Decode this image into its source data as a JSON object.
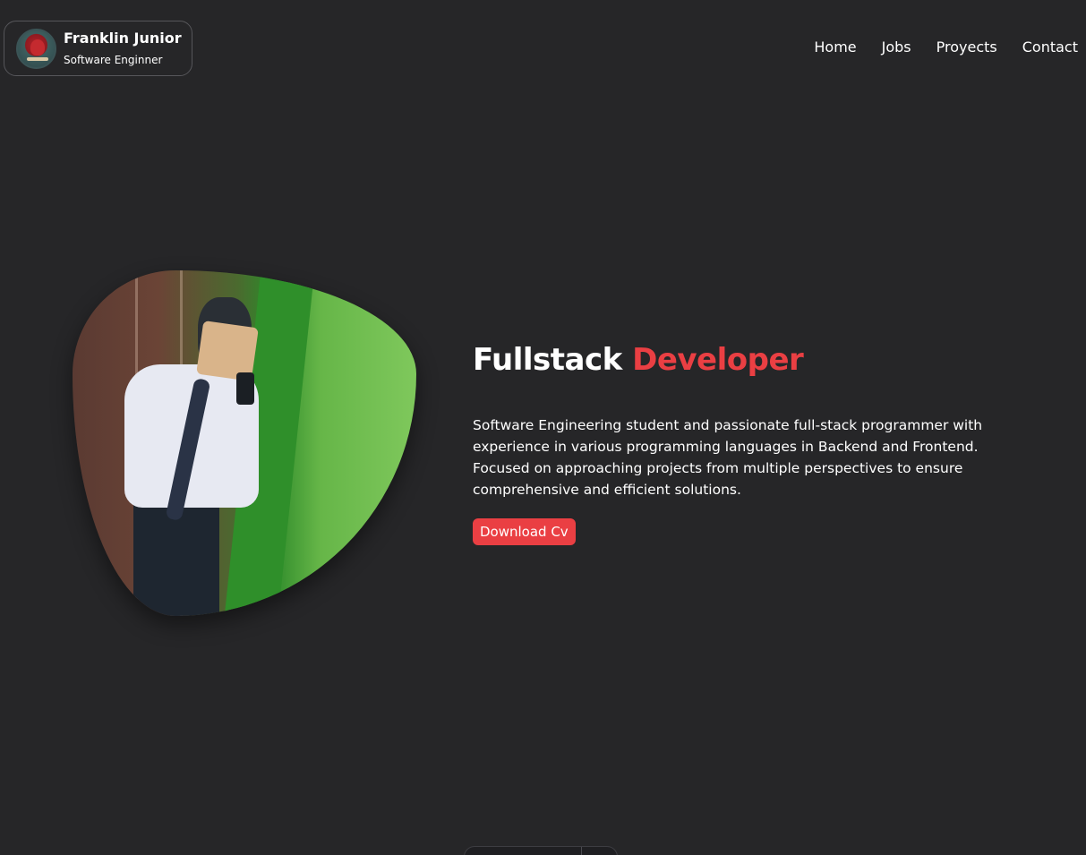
{
  "brand": {
    "name": "Franklin Junior",
    "role": "Software Enginner"
  },
  "nav": {
    "items": [
      {
        "label": "Home"
      },
      {
        "label": "Jobs"
      },
      {
        "label": "Proyects"
      },
      {
        "label": "Contact"
      }
    ]
  },
  "hero": {
    "title_main": "Fullstack",
    "title_accent": "Developer",
    "description": "Software Engineering student and passionate full-stack programmer with experience in various programming languages in Backend and Frontend. Focused on approaching projects from multiple perspectives to ensure comprehensive and efficient solutions.",
    "cv_button_label": "Download Cv"
  },
  "colors": {
    "background": "#262628",
    "accent": "#ea3f43",
    "text": "#ffffff"
  }
}
